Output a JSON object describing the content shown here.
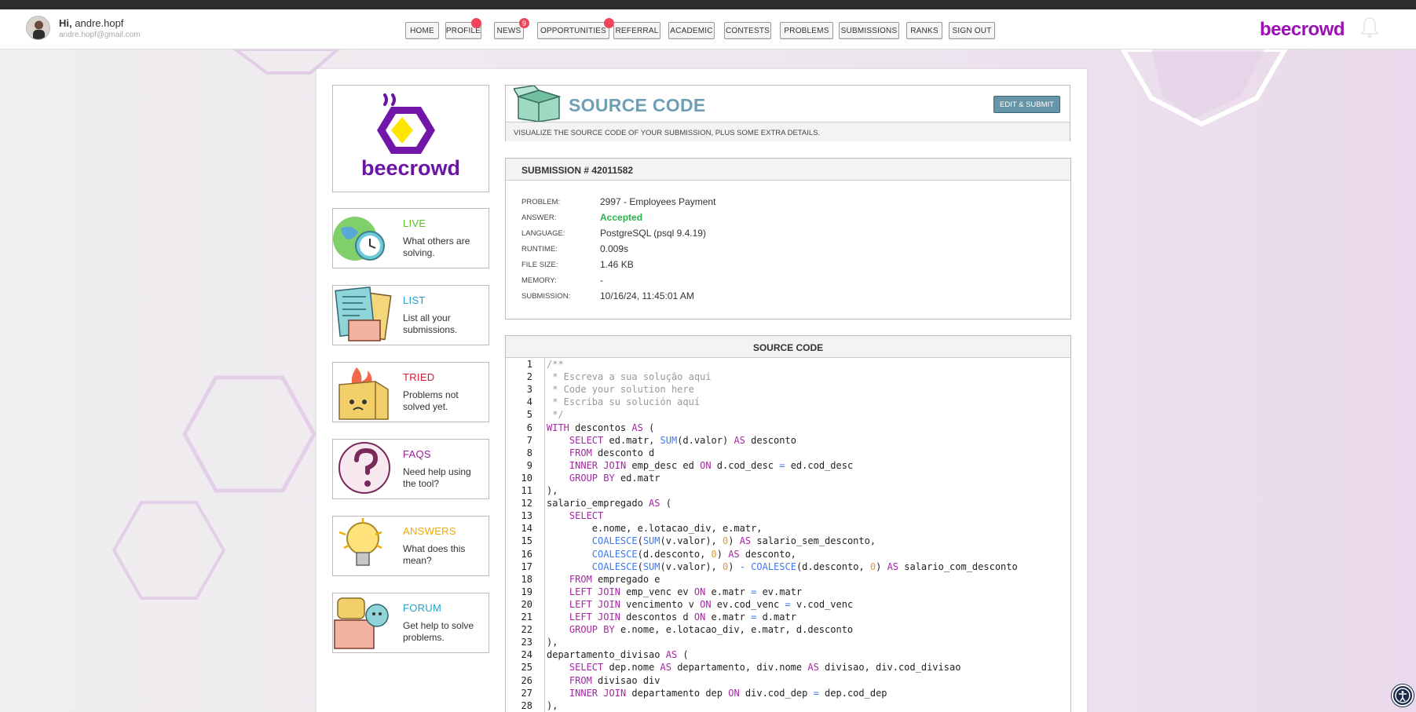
{
  "user": {
    "greeting_prefix": "Hi,",
    "name": "andre.hopf",
    "email": "andre.hopf@gmail.com"
  },
  "nav": [
    {
      "label": "HOME",
      "badge": ""
    },
    {
      "label": "PROFILE",
      "badge": "dot"
    },
    {
      "label": "NEWS",
      "badge": "9"
    },
    {
      "label": "OPPORTUNITIES",
      "badge": "dot"
    },
    {
      "label": "REFERRAL",
      "badge": ""
    },
    {
      "label": "ACADEMIC",
      "badge": ""
    },
    {
      "label": "CONTESTS",
      "badge": ""
    },
    {
      "label": "PROBLEMS",
      "badge": ""
    },
    {
      "label": "SUBMISSIONS",
      "badge": ""
    },
    {
      "label": "RANKS",
      "badge": ""
    },
    {
      "label": "SIGN OUT",
      "badge": ""
    }
  ],
  "brand": "beecrowd",
  "logo_text": "beecrowd",
  "sidebar": [
    {
      "title": "LIVE",
      "desc": "What others are solving.",
      "color": "#5cc128"
    },
    {
      "title": "LIST",
      "desc": "List all your submissions.",
      "color": "#1fa3c8"
    },
    {
      "title": "TRIED",
      "desc": "Problems not solved yet.",
      "color": "#d11c2f"
    },
    {
      "title": "FAQS",
      "desc": "Need help using the tool?",
      "color": "#9a1b9a"
    },
    {
      "title": "ANSWERS",
      "desc": "What does this mean?",
      "color": "#f2a900"
    },
    {
      "title": "FORUM",
      "desc": "Get help to solve problems.",
      "color": "#1fa3c8"
    }
  ],
  "source_header": {
    "title": "SOURCE CODE",
    "edit_button": "EDIT & SUBMIT",
    "subtitle": "VISUALIZE THE SOURCE CODE OF YOUR SUBMISSION, PLUS SOME EXTRA DETAILS."
  },
  "submission": {
    "heading": "SUBMISSION # 42011582",
    "fields": [
      {
        "label": "PROBLEM:",
        "value": "2997 - Employees Payment"
      },
      {
        "label": "ANSWER:",
        "value": "Accepted"
      },
      {
        "label": "LANGUAGE:",
        "value": "PostgreSQL (psql 9.4.19)"
      },
      {
        "label": "RUNTIME:",
        "value": "0.009s"
      },
      {
        "label": "FILE SIZE:",
        "value": "1.46 KB"
      },
      {
        "label": "MEMORY:",
        "value": "-"
      },
      {
        "label": "SUBMISSION:",
        "value": "10/16/24, 11:45:01 AM"
      }
    ]
  },
  "code_section": {
    "heading": "SOURCE CODE",
    "lines": [
      "/**",
      " * Escreva a sua solução aqui",
      " * Code your solution here",
      " * Escriba su solución aquí",
      " */",
      "WITH descontos AS (",
      "    SELECT ed.matr, SUM(d.valor) AS desconto",
      "    FROM desconto d",
      "    INNER JOIN emp_desc ed ON d.cod_desc = ed.cod_desc",
      "    GROUP BY ed.matr",
      "),",
      "salario_empregado AS (",
      "    SELECT",
      "        e.nome, e.lotacao_div, e.matr,",
      "        COALESCE(SUM(v.valor), 0) AS salario_sem_desconto,",
      "        COALESCE(d.desconto, 0) AS desconto,",
      "        COALESCE(SUM(v.valor), 0) - COALESCE(d.desconto, 0) AS salario_com_desconto",
      "    FROM empregado e",
      "    LEFT JOIN emp_venc ev ON e.matr = ev.matr",
      "    LEFT JOIN vencimento v ON ev.cod_venc = v.cod_venc",
      "    LEFT JOIN descontos d ON e.matr = d.matr",
      "    GROUP BY e.nome, e.lotacao_div, e.matr, d.desconto",
      "),",
      "departamento_divisao AS (",
      "    SELECT dep.nome AS departamento, div.nome AS divisao, div.cod_divisao",
      "    FROM divisao div",
      "    INNER JOIN departamento dep ON div.cod_dep = dep.cod_dep",
      "),"
    ]
  }
}
